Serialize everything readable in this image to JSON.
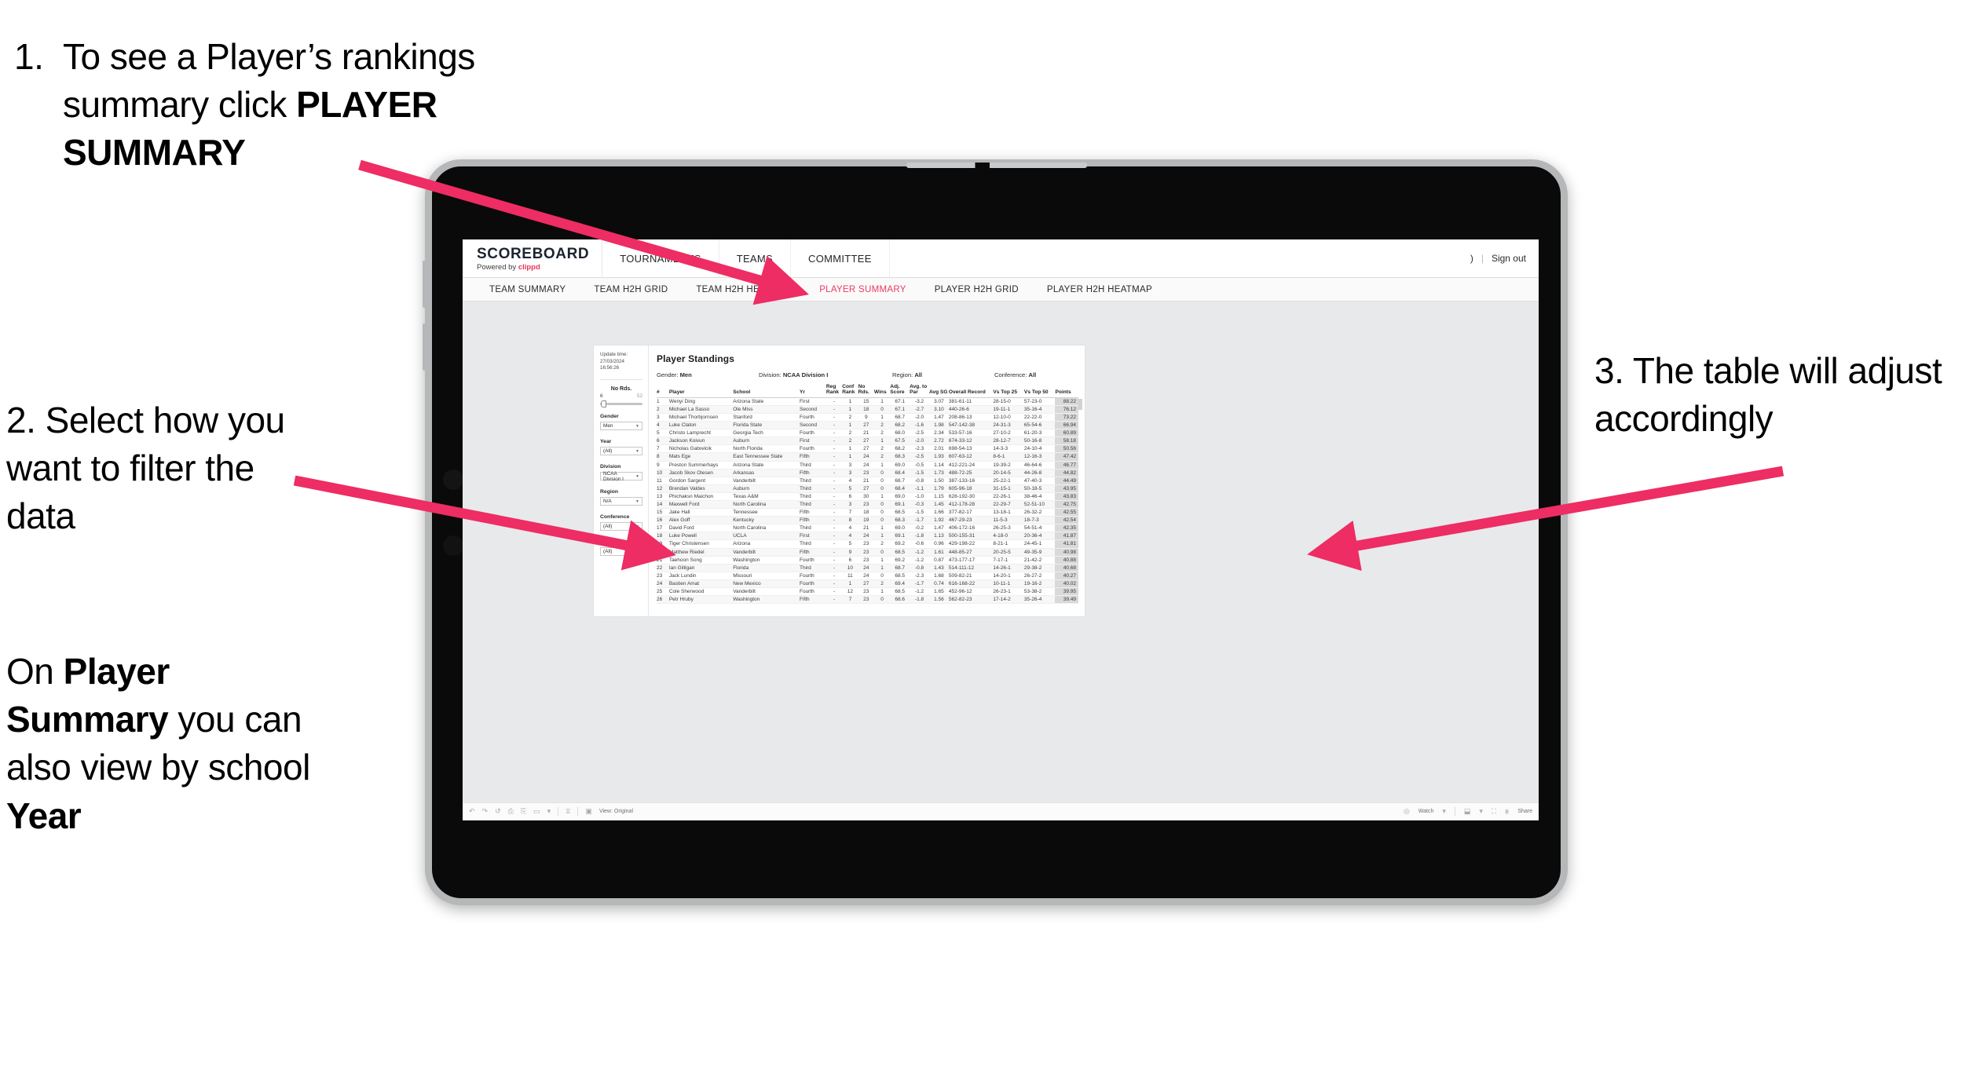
{
  "annotations": {
    "a1_num": "1.",
    "a1_pre": "To see a Player’s rankings summary click ",
    "a1_bold": "PLAYER SUMMARY",
    "a2_line": "2. Select how you want to filter the data",
    "a2b_pre": "On ",
    "a2b_bold1": "Player Summary",
    "a2b_mid": " you can also view by school ",
    "a2b_bold2": "Year",
    "a3_line": "3. The table will adjust accordingly"
  },
  "app": {
    "brand_title": "SCOREBOARD",
    "brand_sub_pre": "Powered by ",
    "brand_sub_brand": "clippd",
    "top_nav": [
      "TOURNAMENTS",
      "TEAMS",
      "COMMITTEE"
    ],
    "header_right_user": ")",
    "header_right_sep": "|",
    "header_right_signout": "Sign out",
    "sub_nav": [
      {
        "label": "TEAM SUMMARY",
        "active": false
      },
      {
        "label": "TEAM H2H GRID",
        "active": false
      },
      {
        "label": "TEAM H2H HEATMAP",
        "active": false
      },
      {
        "label": "PLAYER SUMMARY",
        "active": true
      },
      {
        "label": "PLAYER H2H GRID",
        "active": false
      },
      {
        "label": "PLAYER H2H HEATMAP",
        "active": false
      }
    ],
    "accent_color": "#ec3a63"
  },
  "filters": {
    "update_label": "Update time:",
    "update_value": "27/03/2024 16:56:26",
    "slider": {
      "title": "No Rds.",
      "min": "6",
      "max": "52"
    },
    "controls": [
      {
        "label": "Gender",
        "value": "Men"
      },
      {
        "label": "Year",
        "value": "(All)"
      },
      {
        "label": "Division",
        "value": "NCAA Division I"
      },
      {
        "label": "Region",
        "value": "N/A"
      },
      {
        "label": "Conference",
        "value": "(All)"
      },
      {
        "label": "Player",
        "value": "(All)"
      }
    ]
  },
  "standings": {
    "title": "Player Standings",
    "meta": [
      {
        "label": "Gender:",
        "value": "Men"
      },
      {
        "label": "Division:",
        "value": "NCAA Division I"
      },
      {
        "label": "Region:",
        "value": "All"
      },
      {
        "label": "Conference:",
        "value": "All"
      }
    ],
    "columns": [
      "#",
      "Player",
      "School",
      "Yr",
      "Reg Rank",
      "Conf Rank",
      "No Rds.",
      "Wins",
      "Adj. Score",
      "Avg. to Par",
      "Avg SG",
      "Overall Record",
      "Vs Top 25",
      "Vs Top 50",
      "Points"
    ],
    "rows": [
      [
        "1",
        "Wenyi Ding",
        "Arizona State",
        "First",
        "-",
        "1",
        "15",
        "1",
        "67.1",
        "-3.2",
        "3.07",
        "381-61-11",
        "28-15-0",
        "57-23-0",
        "88.22"
      ],
      [
        "2",
        "Michael La Sasso",
        "Ole Miss",
        "Second",
        "-",
        "1",
        "18",
        "0",
        "67.1",
        "-2.7",
        "3.10",
        "440-26-6",
        "19-11-1",
        "35-16-4",
        "76.12"
      ],
      [
        "3",
        "Michael Thorbjornsen",
        "Stanford",
        "Fourth",
        "-",
        "2",
        "9",
        "1",
        "68.7",
        "-2.0",
        "1.47",
        "208-86-13",
        "12-10-0",
        "22-22-0",
        "73.22"
      ],
      [
        "4",
        "Luke Claton",
        "Florida State",
        "Second",
        "-",
        "1",
        "27",
        "2",
        "68.2",
        "-1.6",
        "1.98",
        "547-142-38",
        "24-31-3",
        "65-54-6",
        "66.94"
      ],
      [
        "5",
        "Christo Lamprecht",
        "Georgia Tech",
        "Fourth",
        "-",
        "2",
        "21",
        "2",
        "68.0",
        "-2.5",
        "2.34",
        "533-57-16",
        "27-10-2",
        "61-20-3",
        "60.89"
      ],
      [
        "6",
        "Jackson Koivun",
        "Auburn",
        "First",
        "-",
        "2",
        "27",
        "1",
        "67.5",
        "-2.0",
        "2.72",
        "674-33-12",
        "28-12-7",
        "50-16-8",
        "58.18"
      ],
      [
        "7",
        "Nicholas Gabrelcik",
        "North Florida",
        "Fourth",
        "-",
        "1",
        "27",
        "2",
        "68.2",
        "-2.3",
        "2.01",
        "698-54-13",
        "14-3-3",
        "24-10-4",
        "50.56"
      ],
      [
        "8",
        "Mats Ege",
        "East Tennessee State",
        "Fifth",
        "-",
        "1",
        "24",
        "2",
        "68.3",
        "-2.5",
        "1.93",
        "607-63-12",
        "8-6-1",
        "12-16-3",
        "47.42"
      ],
      [
        "9",
        "Preston Summerhays",
        "Arizona State",
        "Third",
        "-",
        "3",
        "24",
        "1",
        "69.0",
        "-0.5",
        "1.14",
        "412-221-24",
        "19-39-2",
        "46-64-6",
        "46.77"
      ],
      [
        "10",
        "Jacob Skov Olesen",
        "Arkansas",
        "Fifth",
        "-",
        "3",
        "23",
        "0",
        "68.4",
        "-1.5",
        "1.73",
        "488-72-25",
        "20-14-5",
        "44-26-8",
        "44.82"
      ],
      [
        "11",
        "Gordon Sargent",
        "Vanderbilt",
        "Third",
        "-",
        "4",
        "21",
        "0",
        "68.7",
        "-0.8",
        "1.50",
        "387-133-16",
        "25-22-1",
        "47-40-3",
        "44.49"
      ],
      [
        "12",
        "Brendan Valdes",
        "Auburn",
        "Third",
        "-",
        "5",
        "27",
        "0",
        "68.4",
        "-1.1",
        "1.79",
        "605-96-18",
        "31-15-1",
        "50-18-5",
        "43.95"
      ],
      [
        "13",
        "Phichaksn Maichon",
        "Texas A&M",
        "Third",
        "-",
        "6",
        "30",
        "1",
        "69.0",
        "-1.0",
        "1.15",
        "628-192-30",
        "22-26-1",
        "38-46-4",
        "43.83"
      ],
      [
        "14",
        "Maxwell Ford",
        "North Carolina",
        "Third",
        "-",
        "3",
        "23",
        "0",
        "69.1",
        "-0.3",
        "1.45",
        "412-178-28",
        "22-29-7",
        "52-51-10",
        "42.75"
      ],
      [
        "15",
        "Jake Hall",
        "Tennessee",
        "Fifth",
        "-",
        "7",
        "18",
        "0",
        "68.5",
        "-1.5",
        "1.66",
        "377-82-17",
        "13-18-1",
        "26-32-2",
        "42.55"
      ],
      [
        "16",
        "Alex Goff",
        "Kentucky",
        "Fifth",
        "-",
        "8",
        "19",
        "0",
        "68.3",
        "-1.7",
        "1.92",
        "467-29-23",
        "11-5-3",
        "18-7-3",
        "42.54"
      ],
      [
        "17",
        "David Ford",
        "North Carolina",
        "Third",
        "-",
        "4",
        "21",
        "1",
        "69.0",
        "-0.2",
        "1.47",
        "406-172-16",
        "26-25-3",
        "54-51-4",
        "42.35"
      ],
      [
        "18",
        "Luke Powell",
        "UCLA",
        "First",
        "-",
        "4",
        "24",
        "1",
        "69.1",
        "-1.8",
        "1.13",
        "500-155-31",
        "4-18-0",
        "20-36-4",
        "41.87"
      ],
      [
        "19",
        "Tiger Christensen",
        "Arizona",
        "Third",
        "-",
        "5",
        "23",
        "2",
        "69.2",
        "-0.6",
        "0.96",
        "429-198-22",
        "8-21-1",
        "24-45-1",
        "41.81"
      ],
      [
        "20",
        "Matthew Riedel",
        "Vanderbilt",
        "Fifth",
        "-",
        "9",
        "23",
        "0",
        "68.5",
        "-1.2",
        "1.61",
        "448-85-27",
        "20-25-5",
        "49-35-9",
        "40.98"
      ],
      [
        "21",
        "Taehoon Song",
        "Washington",
        "Fourth",
        "-",
        "6",
        "23",
        "1",
        "69.2",
        "-1.2",
        "0.87",
        "473-177-17",
        "7-17-1",
        "21-42-2",
        "40.88"
      ],
      [
        "22",
        "Ian Gilligan",
        "Florida",
        "Third",
        "-",
        "10",
        "24",
        "1",
        "68.7",
        "-0.8",
        "1.43",
        "514-111-12",
        "14-26-1",
        "29-38-2",
        "40.68"
      ],
      [
        "23",
        "Jack Lundin",
        "Missouri",
        "Fourth",
        "-",
        "11",
        "24",
        "0",
        "68.5",
        "-2.3",
        "1.68",
        "509-82-21",
        "14-20-1",
        "26-27-2",
        "40.27"
      ],
      [
        "24",
        "Bastien Amat",
        "New Mexico",
        "Fourth",
        "-",
        "1",
        "27",
        "2",
        "69.4",
        "-1.7",
        "0.74",
        "616-168-22",
        "10-11-1",
        "19-16-2",
        "40.02"
      ],
      [
        "25",
        "Cole Sherwood",
        "Vanderbilt",
        "Fourth",
        "-",
        "12",
        "23",
        "1",
        "68.5",
        "-1.2",
        "1.65",
        "452-96-12",
        "26-23-1",
        "53-38-2",
        "39.95"
      ],
      [
        "26",
        "Petr Hruby",
        "Washington",
        "Fifth",
        "-",
        "7",
        "23",
        "0",
        "68.6",
        "-1.8",
        "1.56",
        "562-82-23",
        "17-14-2",
        "35-26-4",
        "39.49"
      ]
    ]
  },
  "viz_toolbar": {
    "undo": "↶",
    "redo": "↷",
    "revert": "↺",
    "refresh": "⎙",
    "pause": "⧖",
    "view_label": "View: Original",
    "watch_label": "Watch",
    "share_label": "Share"
  }
}
